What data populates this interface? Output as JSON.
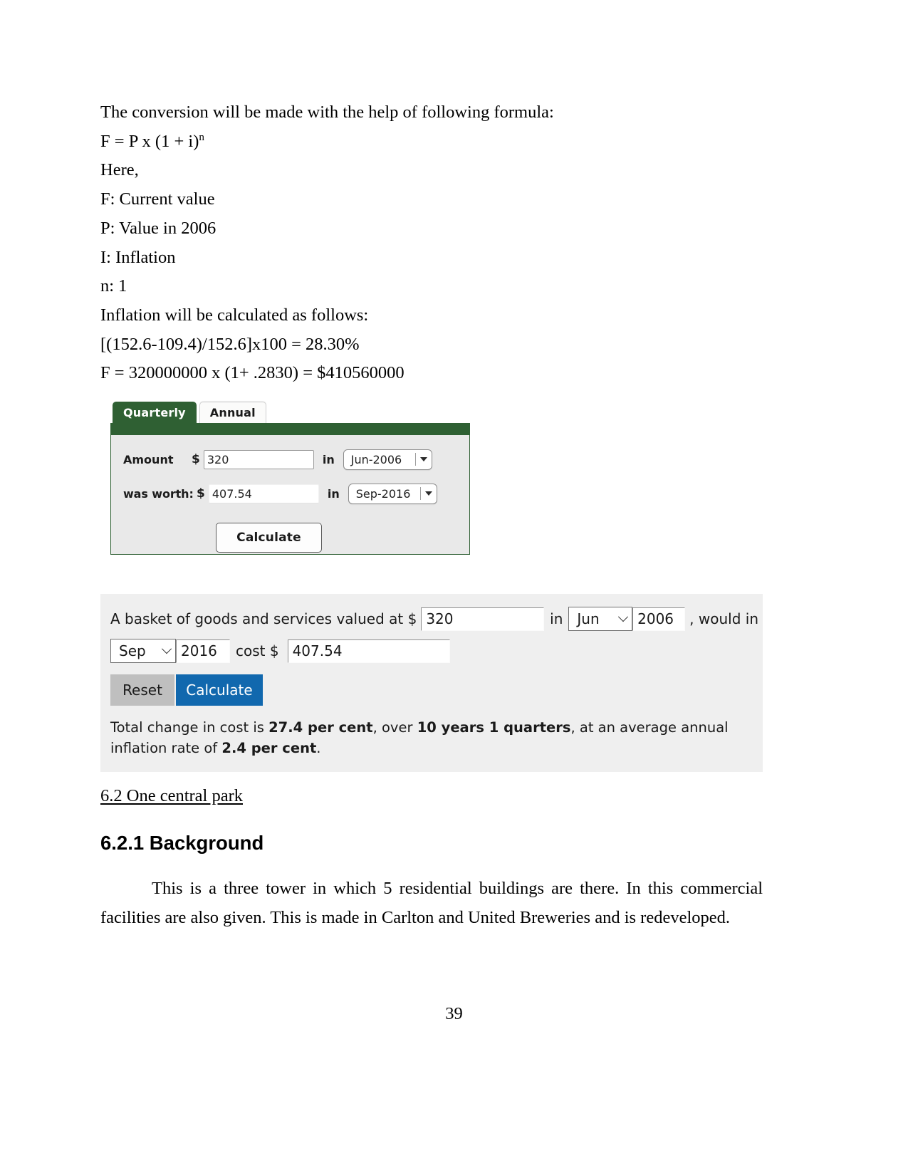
{
  "document": {
    "intro_lines": [
      "The conversion will be made with the help of following formula:",
      "Here,",
      "F: Current value",
      "P: Value in 2006",
      "I: Inflation",
      "n: 1",
      "Inflation will be calculated as follows:",
      "[(152.6-109.4)/152.6]x100 = 28.30%",
      "F = 320000000 x (1+ .2830) = $410560000"
    ],
    "formula_base": "F = P x (1 + i)",
    "formula_exponent": "n",
    "heading_section": "6.2 One central park",
    "heading_subsection": "6.2.1 Background",
    "paragraph": "This is a three tower in which 5 residential buildings are there. In this commercial facilities are also given. This is made in Carlton and United Breweries and is redeveloped.",
    "page_number": "39"
  },
  "quarterly_calculator": {
    "tabs": [
      {
        "label": "Quarterly",
        "active": true
      },
      {
        "label": "Annual",
        "active": false
      }
    ],
    "tab_active_label": "Quarterly",
    "tab_inactive_label": "Annual",
    "row1": {
      "label": "Amount",
      "currency": "$",
      "value": "320",
      "connector": "in",
      "period": "Jun-2006"
    },
    "row2": {
      "label": "was worth:",
      "currency": "$",
      "value": "407.54",
      "connector": "in",
      "period": "Sep-2016"
    },
    "calculate_label": "Calculate",
    "colors": {
      "tab_active_bg": "#2f6033",
      "body_bg": "#e9e9e9"
    }
  },
  "basket_calculator": {
    "lead_text": "A basket of goods and services valued at $",
    "amount_value": "320",
    "in_word_1": "in",
    "from_month": "Jun",
    "from_year": "2006",
    "would_in_text": ", would in",
    "to_month": "Sep",
    "to_year": "2016",
    "cost_label": "cost $",
    "cost_value": "407.54",
    "reset_label": "Reset",
    "calculate_label": "Calculate",
    "result": {
      "part1": "Total change in cost is ",
      "bold1": "27.4 per cent",
      "part2": ", over ",
      "bold2": "10 years 1 quarters",
      "part3": ", at an average annual inflation rate of ",
      "bold3": "2.4 per cent",
      "part4": "."
    },
    "colors": {
      "panel_bg": "#efefef",
      "reset_bg": "#bfbfbf",
      "calculate_bg": "#1168ae"
    }
  }
}
